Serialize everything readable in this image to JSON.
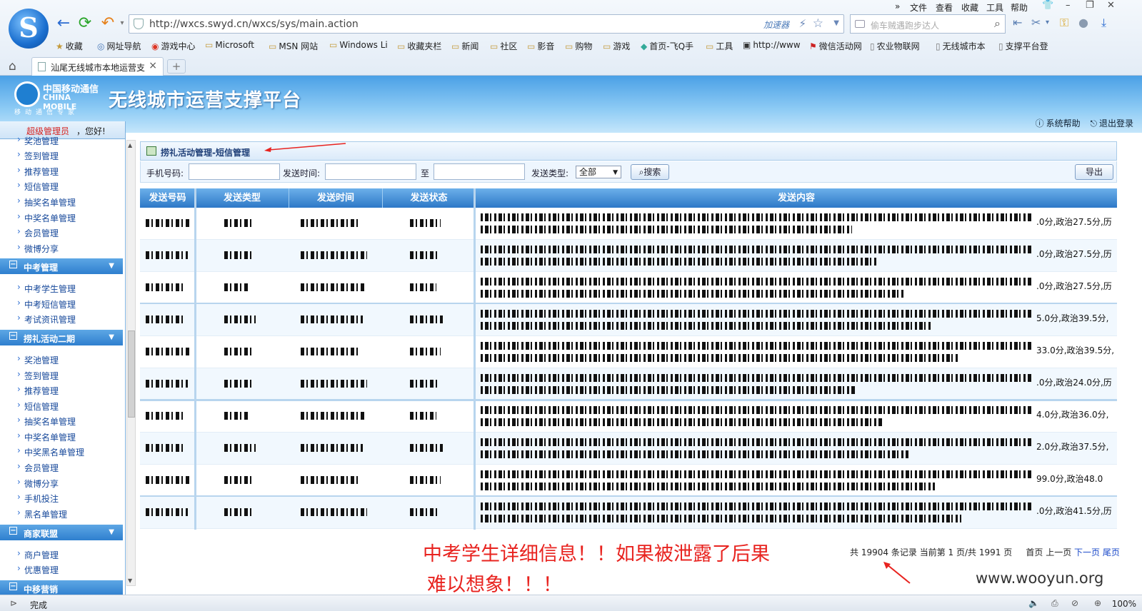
{
  "browser": {
    "url": "http://wxcs.swyd.cn/wxcs/sys/main.action",
    "accelerator": "加速器",
    "search_placeholder": "偷车贼遇跑步达人",
    "menu": [
      "文件",
      "查看",
      "收藏",
      "工具",
      "帮助"
    ],
    "menu_more": "»",
    "bookmarks": [
      "收藏",
      "网址导航",
      "游戏中心",
      "Microsoft",
      "MSN 网站",
      "Windows Li",
      "收藏夹栏",
      "新闻",
      "社区",
      "影音",
      "购物",
      "游戏",
      "首页-飞Q手",
      "工具",
      "http://www",
      "微信活动网",
      "农业物联网",
      "无线城市本",
      "支撑平台登"
    ],
    "tab_title": "汕尾无线城市本地运营支",
    "new_tab": "+",
    "status_text": "完成",
    "zoom": "100%"
  },
  "app": {
    "logo_cn": "中国移动通信",
    "logo_en": "CHINA MOBILE",
    "logo_sub": "移动通信专家",
    "title": "无线城市运营支撑平台",
    "help": "系统帮助",
    "logout": "退出登录"
  },
  "sidebar": {
    "role": "超级管理员",
    "greeting": "，您好!",
    "top_items": [
      "奖池管理",
      "签到管理",
      "推荐管理",
      "短信管理",
      "抽奖名单管理",
      "中奖名单管理",
      "会员管理",
      "微博分享"
    ],
    "groups": [
      {
        "label": "中考管理",
        "items": [
          "中考学生管理",
          "中考短信管理",
          "考试资讯管理"
        ]
      },
      {
        "label": "捞礼活动二期",
        "items": [
          "奖池管理",
          "签到管理",
          "推荐管理",
          "短信管理",
          "抽奖名单管理",
          "中奖名单管理",
          "中奖黑名单管理",
          "会员管理",
          "微博分享",
          "手机投注",
          "黑名单管理"
        ]
      },
      {
        "label": "商家联盟",
        "items": [
          "商户管理",
          "优惠管理"
        ]
      },
      {
        "label": "中移营销",
        "items": []
      }
    ]
  },
  "module": {
    "title": "捞礼活动管理-短信管理"
  },
  "filter": {
    "phone_label": "手机号码:",
    "time_label": "发送时间:",
    "to_label": "至",
    "type_label": "发送类型:",
    "type_value": "全部",
    "search_label": "搜索",
    "export_label": "导出"
  },
  "table": {
    "headers": [
      "发送号码",
      "发送类型",
      "发送时间",
      "发送状态",
      "发送内容"
    ],
    "score_tails": [
      ".0分,政治27.5分,历",
      ".0分,政治27.5分,历",
      ".0分,政治27.5分,历",
      "5.0分,政治39.5分,",
      "33.0分,政治39.5分,",
      ".0分,政治24.0分,历",
      "4.0分,政治36.0分,",
      "2.0分,政治37.5分,",
      "99.0分,政治48.0",
      ".0分,政治41.5分,历"
    ]
  },
  "pager": {
    "total_prefix": "共",
    "total": "19904",
    "total_suffix": "条记录",
    "current_prefix": "当前第",
    "current": "1",
    "of": "页/共",
    "pages": "1991",
    "pages_suffix": "页",
    "first": "首页",
    "prev": "上一页",
    "next": "下一页",
    "last": "尾页"
  },
  "annotation": {
    "line1": "中考学生详细信息！！如果被泄露了后果",
    "line2": "难以想象！！！",
    "watermark": "www.wooyun.org"
  },
  "colors": {
    "annotation_red": "#e8231f",
    "header_blue": "#2d78c7",
    "link_blue": "#1a49c9"
  }
}
